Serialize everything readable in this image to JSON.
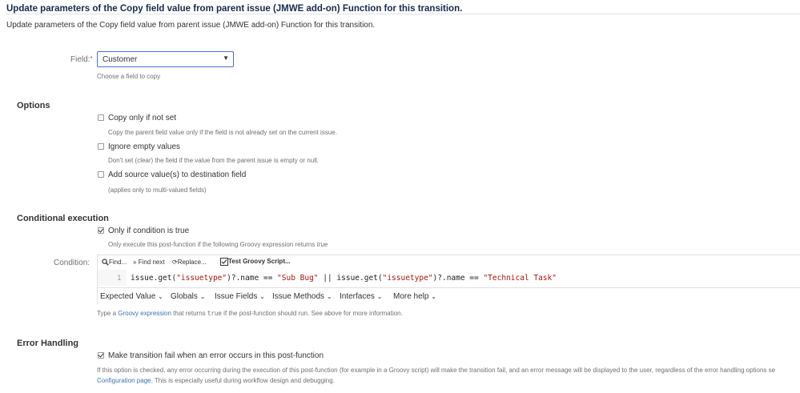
{
  "page": {
    "title": "Update parameters of the Copy field value from parent issue (JMWE add-on) Function for this transition.",
    "subtitle": "Update parameters of the Copy field value from parent issue (JMWE add-on) Function for this transition."
  },
  "field": {
    "label": "Field:",
    "required_marker": "*",
    "value": "Customer",
    "help": "Choose a field to copy"
  },
  "options": {
    "heading": "Options",
    "items": [
      {
        "label": "Copy only if not set",
        "help": "Copy the parent field value only if the field is not already set on the current issue.",
        "checked": false
      },
      {
        "label": "Ignore empty values",
        "help": "Don't set (clear) the field if the value from the parent issue is empty or null.",
        "checked": false
      },
      {
        "label": "Add source value(s) to destination field",
        "help": "(applies only to multi-valued fields)",
        "checked": false
      }
    ]
  },
  "conditional": {
    "heading": "Conditional execution",
    "checkbox_label": "Only if condition is true",
    "checked": true,
    "help_prefix": "Only execute this post-function if the following Groovy expression returns ",
    "help_em": "true",
    "condition_label": "Condition:",
    "toolbar": {
      "find": "Find...",
      "find_next": "Find next",
      "replace": "Replace...",
      "test": "Test Groovy Script..."
    },
    "code": {
      "line_number": "1",
      "p1": "issue.get(",
      "s1": "\"issuetype\"",
      "p2": ")?.name == ",
      "s2": "\"Sub Bug\"",
      "p3": " || issue.get(",
      "s3": "\"issuetype\"",
      "p4": ")?.name == ",
      "s4": "\"Technical Task\""
    },
    "menus": [
      "Expected Value",
      "Globals",
      "Issue Fields",
      "Issue Methods",
      "Interfaces",
      "More help"
    ],
    "help_before": "Type a ",
    "help_link": "Groovy expression",
    "help_middle": " that returns ",
    "help_code": "true",
    "help_after": " if the post-function should run. See above for more information."
  },
  "error_handling": {
    "heading": "Error Handling",
    "checkbox_label": "Make transition fail when an error occurs in this post-function",
    "checked": true,
    "help_line1": "If this option is checked, any error occurring during the execution of this post-function (for example in a Groovy script) will make the transition fail, and an error message will be displayed to the user, regardless of the error handling options se",
    "help_link": "Configuration page",
    "help_line2_after": ". This is especially useful during workflow design and debugging."
  },
  "colors": {
    "link": "#3b73af",
    "select_border": "#4a6ee0",
    "required": "#d04437"
  },
  "icons": [
    "search-icon",
    "find-next-icon",
    "replace-icon",
    "test-script-icon",
    "chevron-down-icon",
    "checkbox-icon"
  ]
}
